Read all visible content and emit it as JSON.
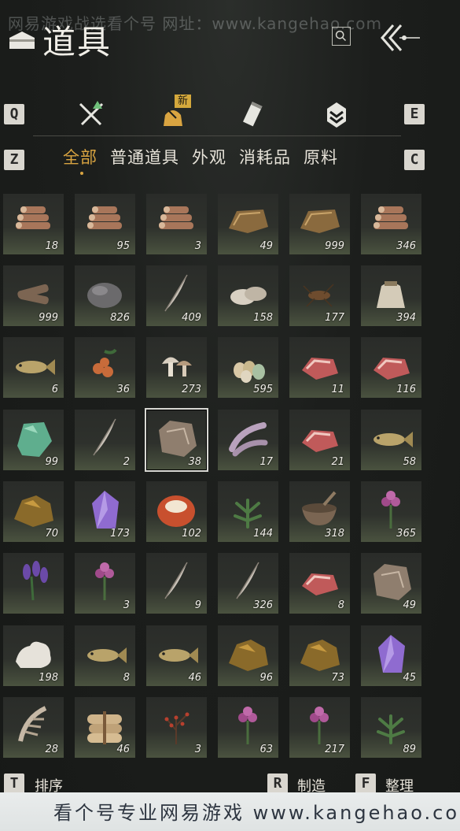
{
  "watermark": {
    "top": "网易游戏战选看个号  网址：www.kangehao.com",
    "bottom": "看个号专业网易游戏 www.kangehao.com"
  },
  "header": {
    "title": "道具"
  },
  "keys": {
    "q": "Q",
    "e": "E",
    "z": "Z",
    "c": "C",
    "t": "T",
    "r": "R",
    "f": "F"
  },
  "tabs": {
    "new_badge": "新"
  },
  "subtabs": [
    "全部",
    "普通道具",
    "外观",
    "消耗品",
    "原料"
  ],
  "footer": {
    "sort": "排序",
    "craft": "制造",
    "organize": "整理"
  },
  "colors": {
    "accent": "#d9a441",
    "new_badge": "#d4a83c",
    "tab_green": "#6fc07a"
  },
  "items": [
    {
      "icon": "logs-icon",
      "count": "18"
    },
    {
      "icon": "logs-icon",
      "count": "95"
    },
    {
      "icon": "logs-icon",
      "count": "3"
    },
    {
      "icon": "bark-icon",
      "count": "49"
    },
    {
      "icon": "bark-icon",
      "count": "999"
    },
    {
      "icon": "logs-icon",
      "count": "346"
    },
    {
      "icon": "firewood-icon",
      "count": "999"
    },
    {
      "icon": "stone-icon",
      "count": "826"
    },
    {
      "icon": "feather-icon",
      "count": "409"
    },
    {
      "icon": "shell-icon",
      "count": "158"
    },
    {
      "icon": "insect-icon",
      "count": "177"
    },
    {
      "icon": "sack-icon",
      "count": "394"
    },
    {
      "icon": "fish-icon",
      "count": "6"
    },
    {
      "icon": "berries-icon",
      "count": "36"
    },
    {
      "icon": "mushroom-icon",
      "count": "273"
    },
    {
      "icon": "eggs-icon",
      "count": "595"
    },
    {
      "icon": "meat-icon",
      "count": "11"
    },
    {
      "icon": "meat-icon",
      "count": "116"
    },
    {
      "icon": "jade-icon",
      "count": "99"
    },
    {
      "icon": "feather-icon",
      "count": "2"
    },
    {
      "icon": "pelt-icon",
      "count": "38",
      "selected": true
    },
    {
      "icon": "tendon-icon",
      "count": "17"
    },
    {
      "icon": "meat-icon",
      "count": "21"
    },
    {
      "icon": "fish-icon",
      "count": "58"
    },
    {
      "icon": "ore-icon",
      "count": "70"
    },
    {
      "icon": "crystal-icon",
      "count": "173"
    },
    {
      "icon": "gem-icon",
      "count": "102"
    },
    {
      "icon": "herb-icon",
      "count": "144"
    },
    {
      "icon": "bowl-icon",
      "count": "318"
    },
    {
      "icon": "flower-icon",
      "count": "365"
    },
    {
      "icon": "lavender-icon",
      "count": ""
    },
    {
      "icon": "flower-icon",
      "count": "3"
    },
    {
      "icon": "feather-icon",
      "count": "9"
    },
    {
      "icon": "feather-icon",
      "count": "326"
    },
    {
      "icon": "meat-icon",
      "count": "8"
    },
    {
      "icon": "pelt-icon",
      "count": "49"
    },
    {
      "icon": "coral-icon",
      "count": "198"
    },
    {
      "icon": "fish-icon",
      "count": "8"
    },
    {
      "icon": "fish-icon",
      "count": "46"
    },
    {
      "icon": "ore-icon",
      "count": "96"
    },
    {
      "icon": "ore-icon",
      "count": "73"
    },
    {
      "icon": "crystal-icon",
      "count": "45"
    },
    {
      "icon": "bone-icon",
      "count": "28"
    },
    {
      "icon": "bundle-icon",
      "count": "46"
    },
    {
      "icon": "branch-icon",
      "count": "3"
    },
    {
      "icon": "flower-icon",
      "count": "63"
    },
    {
      "icon": "flower-icon",
      "count": "217"
    },
    {
      "icon": "herb-icon",
      "count": "89"
    }
  ]
}
